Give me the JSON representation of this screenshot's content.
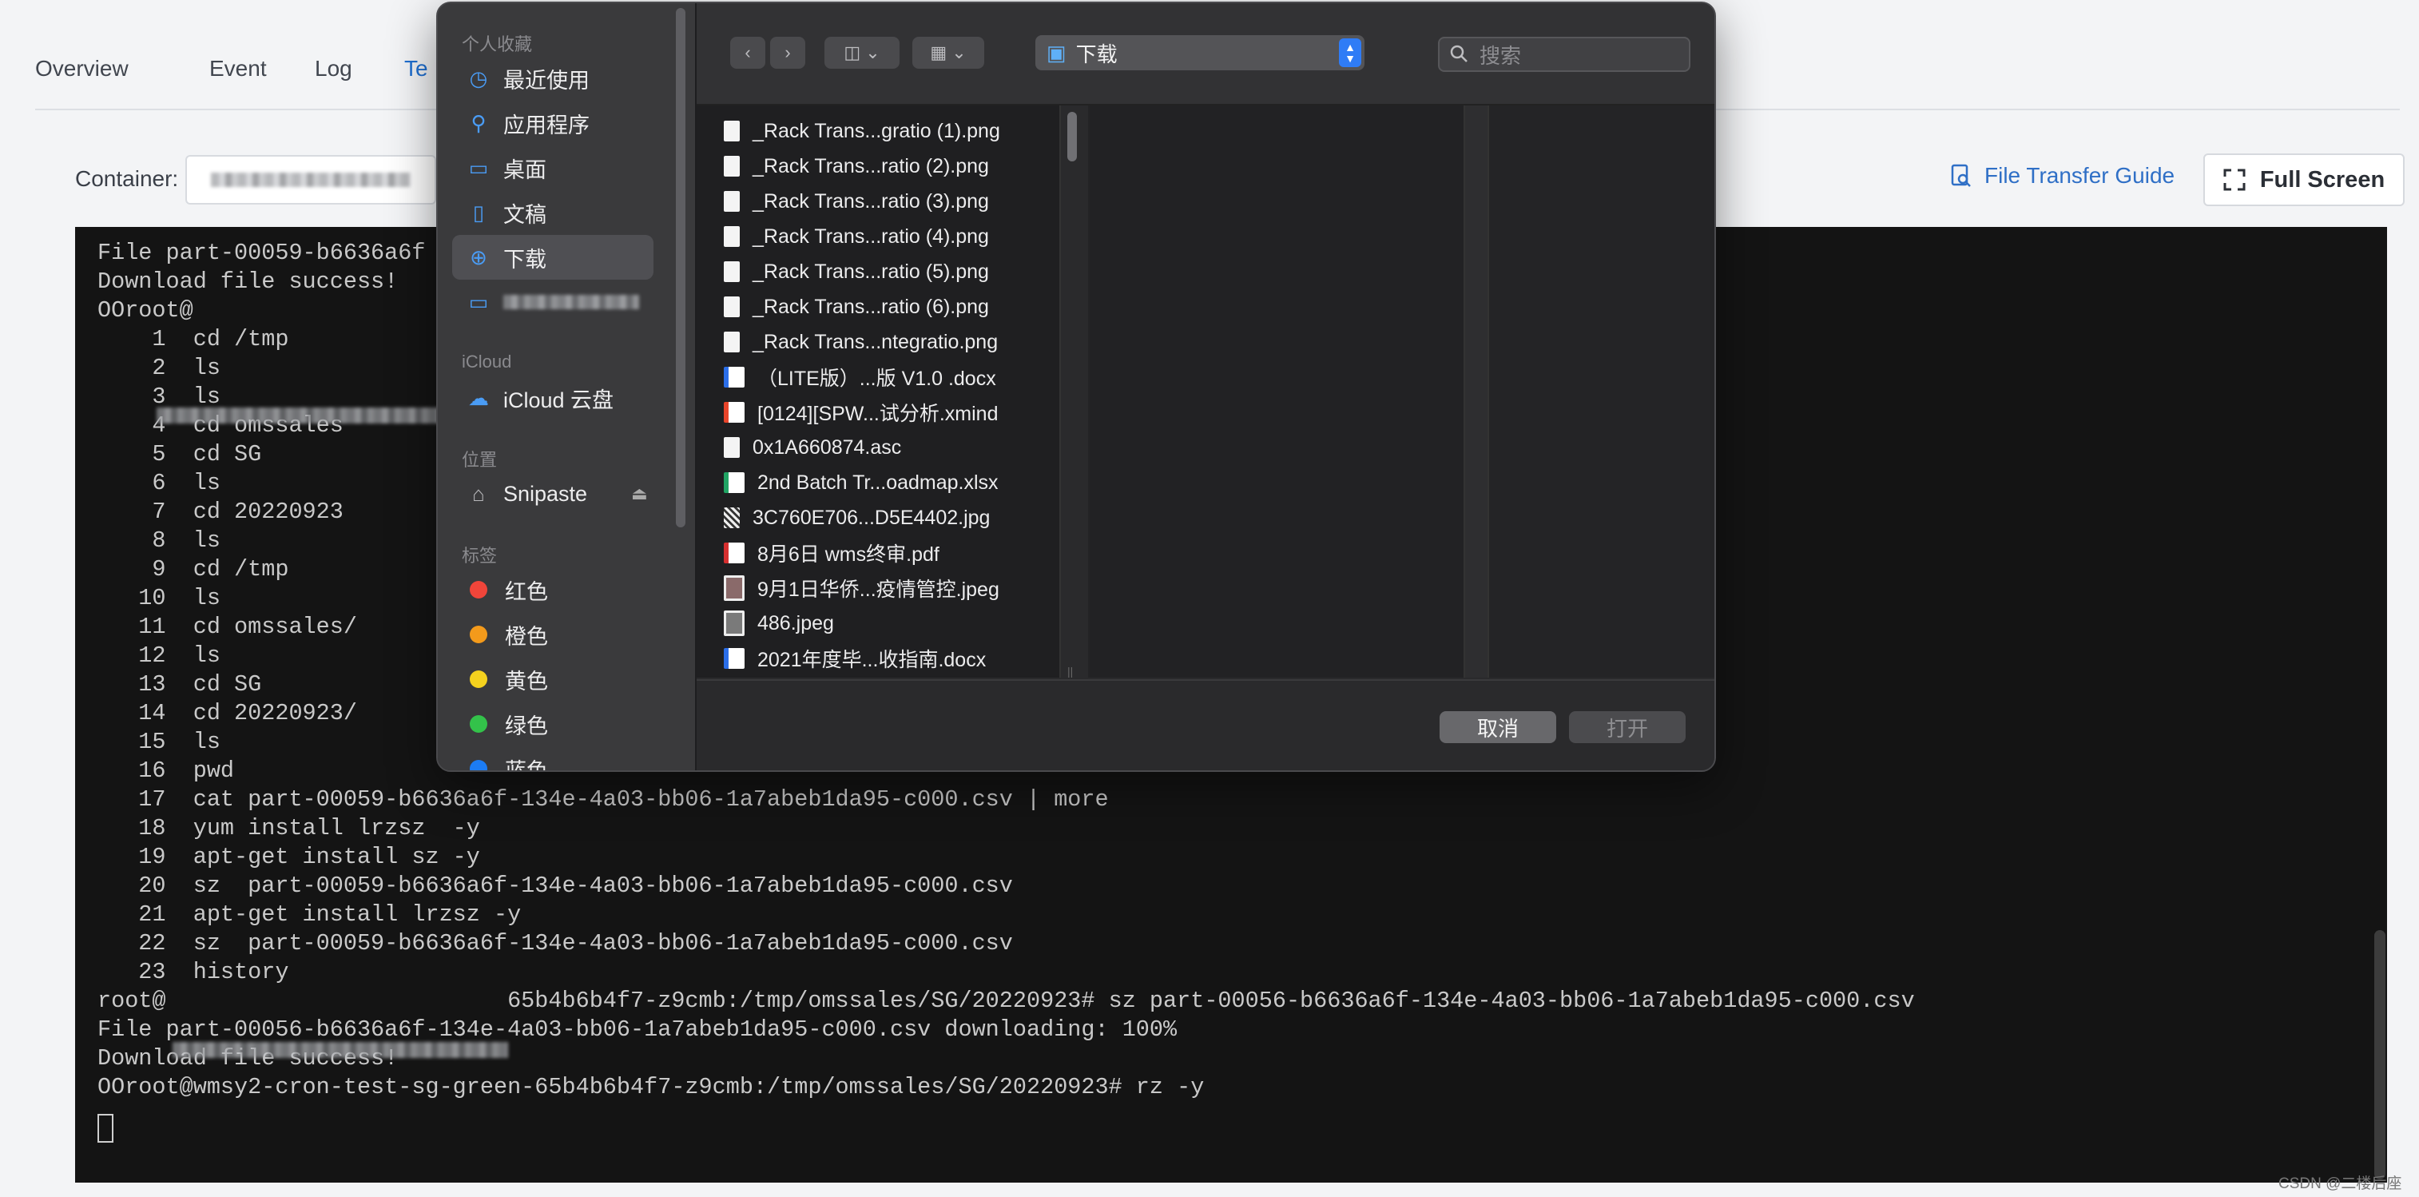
{
  "page": {
    "tabs": [
      "Overview",
      "Event",
      "Log",
      "Te"
    ],
    "container_label": "Container:",
    "file_transfer_guide": "File Transfer Guide",
    "full_screen": "Full Screen",
    "watermark": "CSDN @二楼后座"
  },
  "terminal": {
    "lines": [
      "File part-00059-b6636a6f",
      "Download file success!",
      "OOroot@",
      "    1  cd /tmp",
      "    2  ls",
      "    3  ls",
      "    4  cd omssales",
      "    5  cd SG",
      "    6  ls",
      "    7  cd 20220923",
      "    8  ls",
      "    9  cd /tmp",
      "   10  ls",
      "   11  cd omssales/",
      "   12  ls",
      "   13  cd SG",
      "   14  cd 20220923/",
      "   15  ls",
      "   16  pwd",
      "   17  cat part-00059-b6636a6f-134e-4a03-bb06-1a7abeb1da95-c000.csv | more",
      "   18  yum install lrzsz  -y",
      "   19  apt-get install sz -y",
      "   20  sz  part-00059-b6636a6f-134e-4a03-bb06-1a7abeb1da95-c000.csv",
      "   21  apt-get install lrzsz -y",
      "   22  sz  part-00059-b6636a6f-134e-4a03-bb06-1a7abeb1da95-c000.csv",
      "   23  history",
      "root@                         65b4b6b4f7-z9cmb:/tmp/omssales/SG/20220923# sz part-00056-b6636a6f-134e-4a03-bb06-1a7abeb1da95-c000.csv",
      "File part-00056-b6636a6f-134e-4a03-bb06-1a7abeb1da95-c000.csv downloading: 100%",
      "Download file success!",
      "OOroot@wmsy2-cron-test-sg-green-65b4b6b4f7-z9cmb:/tmp/omssales/SG/20220923# rz -y"
    ]
  },
  "dialog": {
    "sidebar": {
      "favorites_header": "个人收藏",
      "favorites": [
        {
          "label": "最近使用",
          "icon": "clock-icon",
          "glyph": "◷"
        },
        {
          "label": "应用程序",
          "icon": "apps-icon",
          "glyph": "⚲"
        },
        {
          "label": "桌面",
          "icon": "desktop-icon",
          "glyph": "▭"
        },
        {
          "label": "文稿",
          "icon": "document-icon",
          "glyph": "▯"
        },
        {
          "label": "下载",
          "icon": "download-icon",
          "glyph": "⊕"
        }
      ],
      "icloud_header": "iCloud",
      "icloud_drive": "iCloud 云盘",
      "locations_header": "位置",
      "location_item": "Snipaste",
      "tags_header": "标签",
      "tags": [
        {
          "label": "红色",
          "color": "#f0453a"
        },
        {
          "label": "橙色",
          "color": "#f39a1b"
        },
        {
          "label": "黄色",
          "color": "#f5d21e"
        },
        {
          "label": "绿色",
          "color": "#33c24a"
        },
        {
          "label": "蓝色",
          "color": "#1c7cf4"
        }
      ]
    },
    "toolbar": {
      "location": "下载",
      "search_placeholder": "搜索"
    },
    "files": [
      {
        "name": "_Rack Trans...gratio (1).png",
        "type": "png"
      },
      {
        "name": "_Rack Trans...ratio (2).png",
        "type": "png"
      },
      {
        "name": "_Rack Trans...ratio (3).png",
        "type": "png"
      },
      {
        "name": "_Rack Trans...ratio (4).png",
        "type": "png"
      },
      {
        "name": "_Rack Trans...ratio (5).png",
        "type": "png"
      },
      {
        "name": "_Rack Trans...ratio (6).png",
        "type": "png"
      },
      {
        "name": "_Rack Trans...ntegratio.png",
        "type": "png"
      },
      {
        "name": "（LITE版）...版 V1.0 .docx",
        "type": "word"
      },
      {
        "name": "[0124][SPW...试分析.xmind",
        "type": "xmind"
      },
      {
        "name": "0x1A660874.asc",
        "type": "plain"
      },
      {
        "name": "2nd Batch Tr...oadmap.xlsx",
        "type": "excel"
      },
      {
        "name": "3C760E706...D5E4402.jpg",
        "type": "qr"
      },
      {
        "name": "8月6日 wms终审.pdf",
        "type": "pdf"
      },
      {
        "name": "9月1日华侨...疫情管控.jpeg",
        "type": "jpg2"
      },
      {
        "name": "486.jpeg",
        "type": "img"
      },
      {
        "name": "2021年度毕...收指南.docx",
        "type": "word"
      }
    ],
    "buttons": {
      "cancel": "取消",
      "open": "打开"
    }
  }
}
